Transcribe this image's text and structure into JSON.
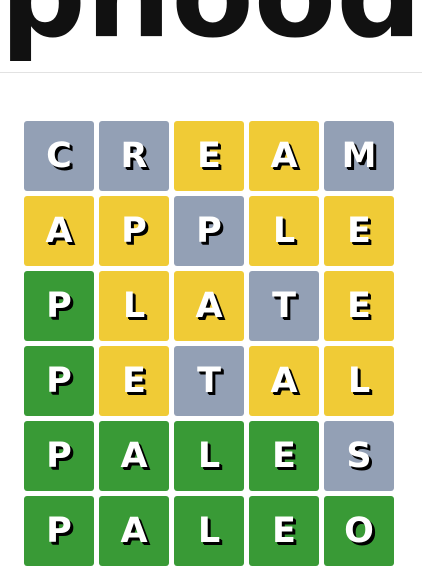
{
  "header": {
    "logo_text": "phoodle"
  },
  "colors": {
    "gray": "#93a0b5",
    "yellow": "#f0cb36",
    "green": "#399a36",
    "text": "#ffffff",
    "shadow": "#000000"
  },
  "board": {
    "rows": [
      {
        "guess": "CREAM",
        "tiles": [
          {
            "letter": "C",
            "state": "gray"
          },
          {
            "letter": "R",
            "state": "gray"
          },
          {
            "letter": "E",
            "state": "yellow"
          },
          {
            "letter": "A",
            "state": "yellow"
          },
          {
            "letter": "M",
            "state": "gray"
          }
        ]
      },
      {
        "guess": "APPLE",
        "tiles": [
          {
            "letter": "A",
            "state": "yellow"
          },
          {
            "letter": "P",
            "state": "yellow"
          },
          {
            "letter": "P",
            "state": "gray"
          },
          {
            "letter": "L",
            "state": "yellow"
          },
          {
            "letter": "E",
            "state": "yellow"
          }
        ]
      },
      {
        "guess": "PLATE",
        "tiles": [
          {
            "letter": "P",
            "state": "green"
          },
          {
            "letter": "L",
            "state": "yellow"
          },
          {
            "letter": "A",
            "state": "yellow"
          },
          {
            "letter": "T",
            "state": "gray"
          },
          {
            "letter": "E",
            "state": "yellow"
          }
        ]
      },
      {
        "guess": "PETAL",
        "tiles": [
          {
            "letter": "P",
            "state": "green"
          },
          {
            "letter": "E",
            "state": "yellow"
          },
          {
            "letter": "T",
            "state": "gray"
          },
          {
            "letter": "A",
            "state": "yellow"
          },
          {
            "letter": "L",
            "state": "yellow"
          }
        ]
      },
      {
        "guess": "PALES",
        "tiles": [
          {
            "letter": "P",
            "state": "green"
          },
          {
            "letter": "A",
            "state": "green"
          },
          {
            "letter": "L",
            "state": "green"
          },
          {
            "letter": "E",
            "state": "green"
          },
          {
            "letter": "S",
            "state": "gray"
          }
        ]
      },
      {
        "guess": "PALEO",
        "tiles": [
          {
            "letter": "P",
            "state": "green"
          },
          {
            "letter": "A",
            "state": "green"
          },
          {
            "letter": "L",
            "state": "green"
          },
          {
            "letter": "E",
            "state": "green"
          },
          {
            "letter": "O",
            "state": "green"
          }
        ]
      }
    ]
  }
}
